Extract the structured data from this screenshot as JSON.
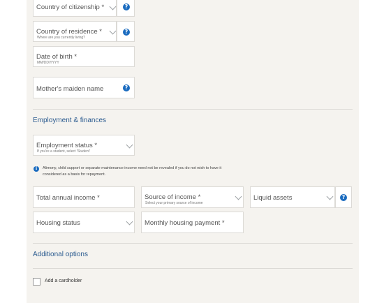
{
  "personal": {
    "citizenship_label": "Country of citizenship *",
    "residence_label": "Country of residence *",
    "residence_hint": "Where are you currently living?",
    "dob_label": "Date of birth *",
    "dob_hint": "MM/DD/YYYY",
    "maiden_label": "Mother's maiden name"
  },
  "employment": {
    "section_title": "Employment & finances",
    "status_label": "Employment status *",
    "status_hint": "If you're a student, select 'Student'",
    "info_icon": "i",
    "note_line1": "Alimony, child support or separate maintenance income need not be revealed if you do not wish to have it",
    "note_line2": "considered as a basis for repayment.",
    "income_label": "Total annual income *",
    "source_label": "Source of income *",
    "source_hint": "Select your primary source of income",
    "liquid_label": "Liquid assets",
    "housing_label": "Housing status",
    "payment_label": "Monthly housing payment *"
  },
  "additional": {
    "section_title": "Additional options",
    "cardholder_label": "Add a cardholder"
  },
  "help_glyph": "?",
  "colors": {
    "accent": "#1a6bbf",
    "section_title": "#2a5a8f",
    "panel_bg": "#f5f3ef"
  }
}
